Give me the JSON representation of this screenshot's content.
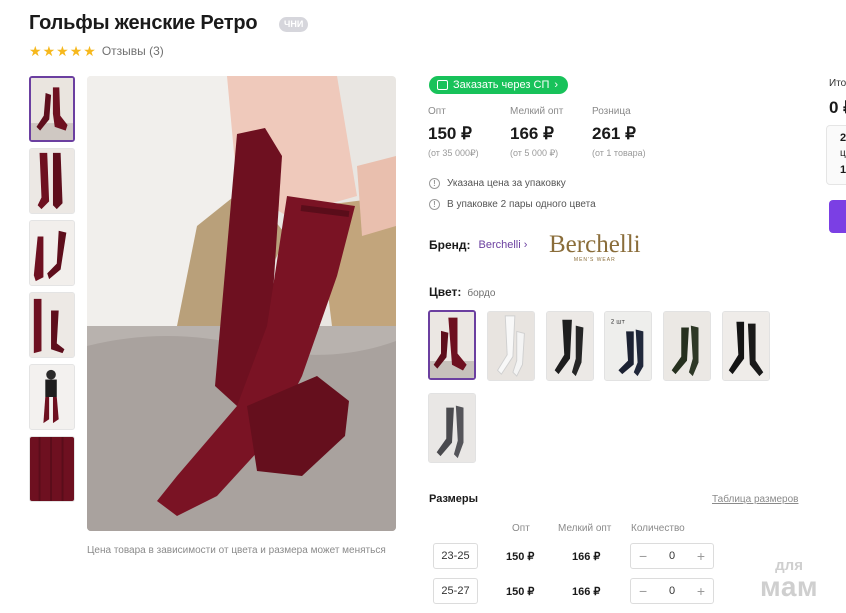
{
  "product": {
    "title": "Гольфы женские Ретро",
    "badge": "ЧНИ",
    "rating_stars": 5,
    "reviews_label": "Отзывы (3)"
  },
  "gallery": {
    "thumbnail_count": 6,
    "selected_index": 0,
    "note": "Цена товара в зависимости от цвета и размера может меняться"
  },
  "purchase": {
    "sp_button_label": "Заказать через СП"
  },
  "prices": [
    {
      "label": "Опт",
      "value": "150 ₽",
      "sub": "(от 35 000₽)"
    },
    {
      "label": "Мелкий опт",
      "value": "166 ₽",
      "sub": "(от 5 000 ₽)"
    },
    {
      "label": "Розница",
      "value": "261 ₽",
      "sub": "(от 1 товара)"
    }
  ],
  "info": [
    "Указана цена за упаковку",
    "В упаковке 2 пары одного цвета"
  ],
  "brand": {
    "label": "Бренд:",
    "name": "Berchelli",
    "logo_text": "Berchelli",
    "logo_subtext": "MEN'S WEAR"
  },
  "color": {
    "label": "Цвет:",
    "value": "бордо",
    "swatches": [
      {
        "name": "бордо",
        "sock": "#6e1020",
        "selected": true
      },
      {
        "name": "белый",
        "sock": "#f4f4f4",
        "selected": false
      },
      {
        "name": "черный",
        "sock": "#1e1e1e",
        "selected": false
      },
      {
        "name": "темно-синий",
        "sock": "#1c2233",
        "selected": false
      },
      {
        "name": "темно-зеленый",
        "sock": "#26301f",
        "selected": false
      },
      {
        "name": "черный",
        "sock": "#141414",
        "selected": false
      },
      {
        "name": "серый",
        "sock": "#4a4a4e",
        "selected": false
      }
    ],
    "swatch_badge": "2 шт"
  },
  "sizes": {
    "title": "Размеры",
    "size_chart_link": "Таблица размеров",
    "columns": [
      "Опт",
      "Мелкий опт",
      "Количество"
    ],
    "rows": [
      {
        "size": "23-25",
        "opt": "150 ₽",
        "small_opt": "166 ₽",
        "qty": "0"
      },
      {
        "size": "25-27",
        "opt": "150 ₽",
        "small_opt": "166 ₽",
        "qty": "0"
      }
    ]
  },
  "summary": {
    "label": "Ито",
    "total": "0 ₽",
    "card_lines": [
      "2",
      "ц",
      "1"
    ]
  },
  "watermark": {
    "line1": "для",
    "line2": "мам"
  },
  "colors": {
    "accent": "#6b3fa0",
    "green": "#18c25a",
    "star": "#f6b81d",
    "sock_main": "#6e1020"
  }
}
